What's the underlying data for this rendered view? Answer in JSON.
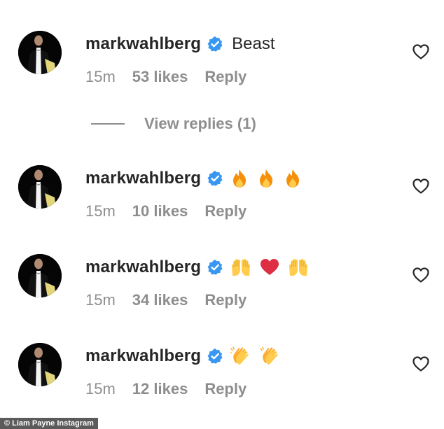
{
  "comments": [
    {
      "username": "markwahlberg",
      "text": "Beast",
      "emojis": [],
      "time": "15m",
      "likes": "53 likes",
      "reply_label": "Reply"
    },
    {
      "username": "markwahlberg",
      "text": "",
      "emojis": [
        "fire-emoji",
        "fire-emoji",
        "fire-emoji"
      ],
      "time": "15m",
      "likes": "10 likes",
      "reply_label": "Reply"
    },
    {
      "username": "markwahlberg",
      "text": "",
      "emojis": [
        "raising-hands-emoji",
        "red-heart-emoji",
        "raising-hands-emoji"
      ],
      "time": "15m",
      "likes": "34 likes",
      "reply_label": "Reply"
    },
    {
      "username": "markwahlberg",
      "text": "",
      "emojis": [
        "clapping-hands-emoji",
        "clapping-hands-emoji"
      ],
      "time": "15m",
      "likes": "12 likes",
      "reply_label": "Reply"
    }
  ],
  "view_replies": "View replies (1)",
  "credit": "© Liam Payne Instagram",
  "colors": {
    "username": "#262626",
    "meta": "#8e8e8e",
    "verified": "#3897f0",
    "avatar_bg": "#050505"
  },
  "icons": {
    "verified": "verified-badge-icon",
    "like": "heart-outline-icon"
  }
}
